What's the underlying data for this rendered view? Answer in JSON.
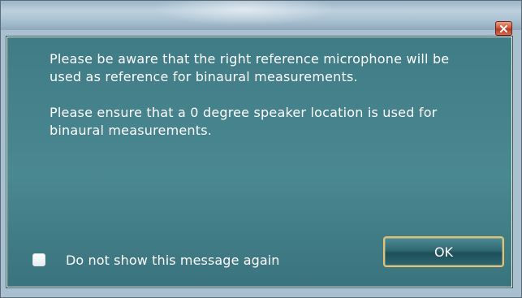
{
  "dialog": {
    "message_paragraph_1": "Please be aware that the right reference microphone will be used as reference for binaural measurements.",
    "message_paragraph_2": "Please ensure that a 0 degree speaker location is used for binaural measurements.",
    "checkbox_label": "Do not show this message again",
    "checkbox_checked": false,
    "ok_label": "OK"
  },
  "titlebar": {
    "close_icon": "close-icon"
  },
  "colors": {
    "content_background": "#4a8891",
    "ok_button_border": "#e8c26a",
    "close_button": "#c94a2c",
    "text": "#ffffff"
  }
}
